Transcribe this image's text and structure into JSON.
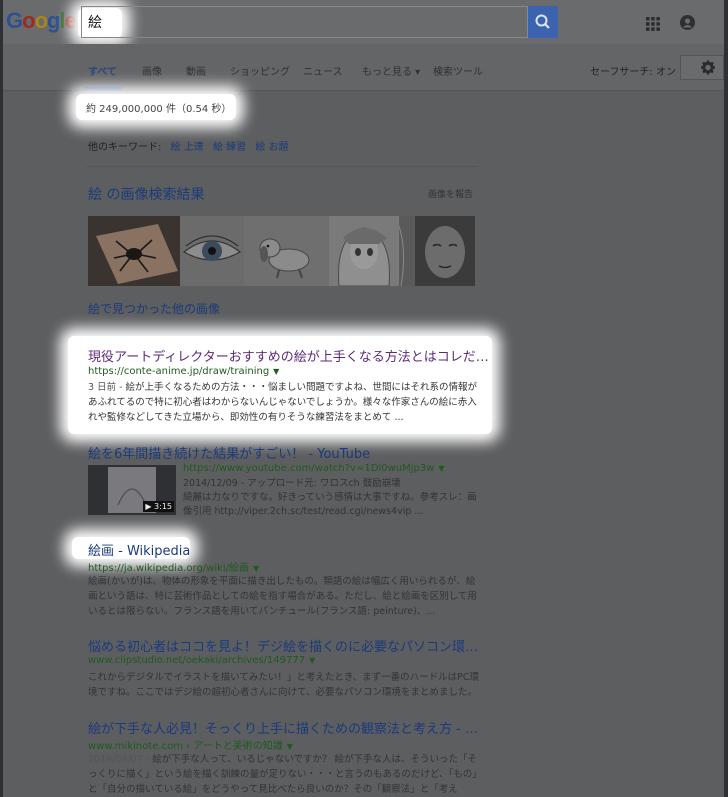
{
  "search": {
    "query": "絵"
  },
  "tabs": [
    {
      "label": "すべて",
      "active": true
    },
    {
      "label": "画像"
    },
    {
      "label": "動画"
    },
    {
      "label": "ショッピング"
    },
    {
      "label": "ニュース"
    },
    {
      "label": "もっと見る ▾"
    },
    {
      "label": "検索ツール"
    }
  ],
  "safesearch": "セーフサーチ: オン",
  "stats": "約 249,000,000 件（0.54 秒）",
  "related": {
    "label": "他のキーワード:",
    "items": [
      "絵 上達",
      "絵 練習",
      "絵 お題"
    ]
  },
  "images": {
    "title": "絵 の画像検索結果",
    "report": "画像を報告",
    "more": "絵で見つかった他の画像"
  },
  "results": [
    {
      "title": "現役アートディレクターおすすめの絵が上手くなる方法とはコレだ…",
      "url": "https://conte-anime.jp/draw/training",
      "date": "3 日前 -",
      "snippet": "絵が上手くなるための方法・・・悩ましい問題ですよね、世間にはそれ系の情報があふれてるので特に初心者はわからないんじゃないでしょうか。様々な作家さんの絵に赤入れや監修などしてきた立場から、即効性の有りそうな練習法をまとめて ..."
    },
    {
      "title": "絵を6年間描き続けた結果がすごい！ - YouTube",
      "url": "https://www.youtube.com/watch?v=1Dl0wuMjp3w",
      "meta1": "2014/12/09 - アップロード元: ワロスch 鼓励崩壊",
      "meta2": "綺麗は力なりですな。好きっていう感情は大事ですね。参考スレ：画像引用 http://viper.2ch.sc/test/read.cgi/news4vip ...",
      "duration": "3:15"
    },
    {
      "title": "絵画 - Wikipedia",
      "url": "https://ja.wikipedia.org/wiki/絵画",
      "snippet": "絵画(かいが)は、物体の形象を平面に描き出したもの。類語の絵は幅広く用いられるが、絵画という語は、特に芸術作品としての絵を指す場合がある。ただし、絵と絵画を区別して用いるとは限らない。フランス語を用いてパンチュール(フランス語: peinture)、..."
    },
    {
      "title": "悩める初心者はココを見よ！デジ絵を描くのに必要なパソコン環…",
      "url": "www.clipstudio.net/oekaki/archives/149777",
      "snippet": "これからデジタルでイラストを描いてみたい！」と考えたとき、まず一番のハードルはPC環境ですね。ここではデジ絵の超初心者さんに向けて、必要なパソコン環境をまとめました。"
    },
    {
      "title": "絵が下手な人必見！そっくり上手に描くための観察法と考え方 - …",
      "url": "www.mikinote.com › アートと美術の知識",
      "date": "2016/09/07 -",
      "snippet": "絵が下手な人って、いるじゃないですか？ 絵が下手な人は、そういった「そっくりに描く」という絵を描く訓練の量が足りない・・・と言うのもあるのだけど、「もの」と「自分の描いている絵」をどうやって見比べたら良いのか？その「観察法」と「考え方」..."
    }
  ]
}
